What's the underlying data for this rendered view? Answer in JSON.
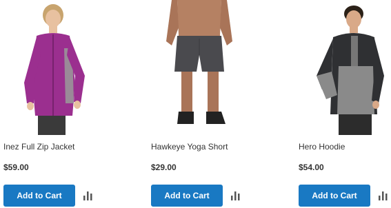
{
  "products": [
    {
      "name": "Inez Full Zip Jacket",
      "price": "$59.00",
      "add_to_cart": "Add to Cart",
      "compare_icon": "compare-icon"
    },
    {
      "name": "Hawkeye Yoga Short",
      "price": "$29.00",
      "add_to_cart": "Add to Cart",
      "compare_icon": "compare-icon"
    },
    {
      "name": "Hero Hoodie",
      "price": "$54.00",
      "add_to_cart": "Add to Cart",
      "compare_icon": "compare-icon"
    }
  ],
  "colors": {
    "button": "#1979c3",
    "button_text": "#ffffff",
    "text": "#333333",
    "jacket": "#9b2f8f",
    "compare_icon": "#555555"
  }
}
